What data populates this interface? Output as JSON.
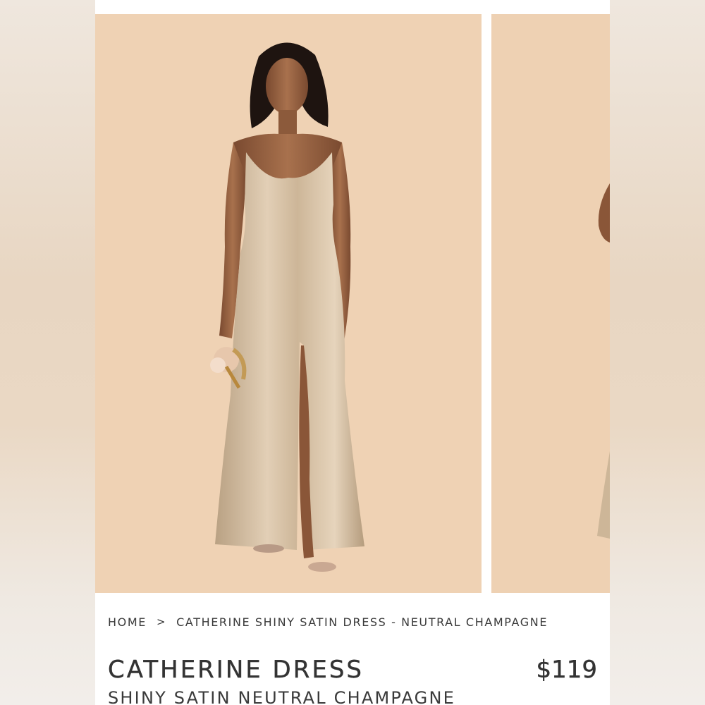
{
  "breadcrumb": {
    "home": "HOME",
    "separator": ">",
    "current": "CATHERINE SHINY SATIN DRESS - NEUTRAL CHAMPAGNE"
  },
  "product": {
    "name": "CATHERINE DRESS",
    "price": "$119",
    "subtitle": "SHINY SATIN NEUTRAL CHAMPAGNE"
  },
  "colors": {
    "photo_background": "#efd2b4",
    "dress": "#cdb79c",
    "text": "#333333"
  }
}
